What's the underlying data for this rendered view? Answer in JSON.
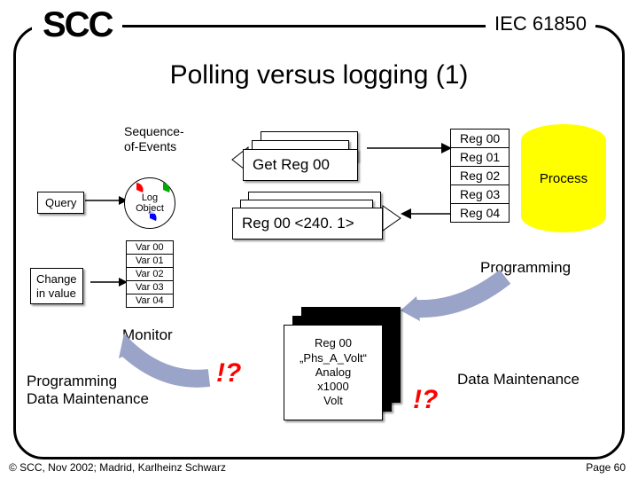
{
  "header": {
    "logo": "SCC",
    "standard": "IEC 61850"
  },
  "title": "Polling versus logging (1)",
  "seq_label_l1": "Sequence-",
  "seq_label_l2": "of-Events",
  "query_label": "Query",
  "change_label_l1": "Change",
  "change_label_l2": "in value",
  "log_object_l1": "Log",
  "log_object_l2": "Object",
  "vars": [
    "Var 00",
    "Var 01",
    "Var 02",
    "Var 03",
    "Var 04"
  ],
  "monitor_label": "Monitor",
  "prog_maint_l1": "Programming",
  "prog_maint_l2": "Data Maintenance",
  "get_tag": "Get Reg 00",
  "resp_tag": "Reg 00 <240. 1>",
  "regs": [
    "Reg 00",
    "Reg 01",
    "Reg 02",
    "Reg 03",
    "Reg 04"
  ],
  "process_label": "Process",
  "programming_label": "Programming",
  "data_maintenance_label": "Data Maintenance",
  "scroll": {
    "l1": "Reg 00",
    "l2": "„Phs_A_Volt“",
    "l3": "Analog",
    "l4": "x1000",
    "l5": "Volt"
  },
  "bang": "!?",
  "footer": {
    "left": "© SCC, Nov 2002; Madrid, Karlheinz Schwarz",
    "right": "Page 60"
  }
}
